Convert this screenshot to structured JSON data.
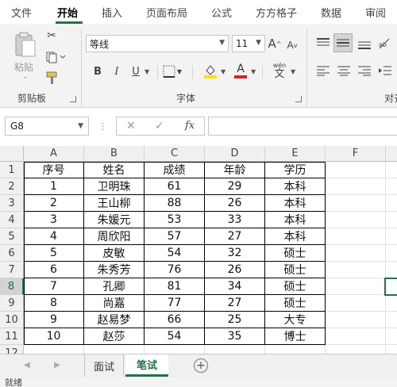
{
  "menu": {
    "tabs": [
      "文件",
      "开始",
      "插入",
      "页面布局",
      "公式",
      "方方格子",
      "数据",
      "审阅"
    ],
    "active": "开始"
  },
  "ribbon": {
    "clipboard": {
      "label": "剪贴板",
      "paste_label": "粘贴"
    },
    "font": {
      "label": "字体",
      "font_name": "等线",
      "font_size": "11",
      "grow": "A",
      "shrink": "A",
      "bold": "B",
      "italic": "I",
      "underline": "U",
      "font_color": "A",
      "phonetic": "wén",
      "phonetic_char": "文"
    },
    "alignment": {
      "label": "对齐"
    }
  },
  "formula_bar": {
    "name_box": "G8",
    "cancel": "✕",
    "enter": "✓",
    "fx": "fx",
    "content": ""
  },
  "grid": {
    "columns": [
      "A",
      "B",
      "C",
      "D",
      "E",
      "F"
    ],
    "rows": [
      "1",
      "2",
      "3",
      "4",
      "5",
      "6",
      "7",
      "8",
      "9",
      "10",
      "11",
      "12"
    ],
    "selected_row": "8",
    "header": [
      "序号",
      "姓名",
      "成绩",
      "年龄",
      "学历"
    ],
    "data": [
      [
        "1",
        "卫明珠",
        "61",
        "29",
        "本科"
      ],
      [
        "2",
        "王山柳",
        "88",
        "26",
        "本科"
      ],
      [
        "3",
        "朱媛元",
        "53",
        "33",
        "本科"
      ],
      [
        "4",
        "周欣阳",
        "57",
        "27",
        "本科"
      ],
      [
        "5",
        "皮敏",
        "54",
        "32",
        "硕士"
      ],
      [
        "6",
        "朱秀芳",
        "76",
        "26",
        "硕士"
      ],
      [
        "7",
        "孔卿",
        "81",
        "34",
        "硕士"
      ],
      [
        "8",
        "尚嘉",
        "77",
        "27",
        "硕士"
      ],
      [
        "9",
        "赵易梦",
        "66",
        "25",
        "大专"
      ],
      [
        "10",
        "赵莎",
        "54",
        "35",
        "博士"
      ]
    ]
  },
  "sheets": {
    "tabs": [
      "面试",
      "笔试"
    ],
    "active": "笔试",
    "add": "+"
  },
  "status": {
    "text": "就绪"
  },
  "colors": {
    "accent": "#217346",
    "font_color_bar": "#e02020",
    "highlight_bar": "#ffe000"
  }
}
